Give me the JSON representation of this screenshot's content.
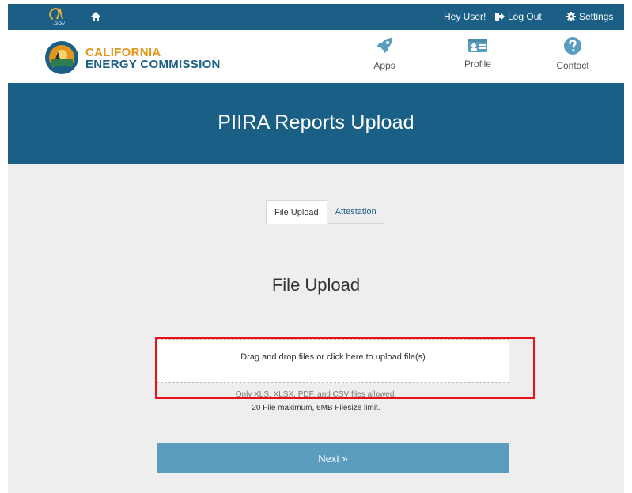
{
  "topbar": {
    "ca_logo_text": "CA.GOV",
    "home_icon": "home-icon",
    "greeting": "Hey User!",
    "logout_label": "Log Out",
    "settings_label": "Settings"
  },
  "header": {
    "brand_line1": "CALIFORNIA",
    "brand_line2": "ENERGY COMMISSION",
    "nav": [
      {
        "label": "Apps",
        "icon": "rocket-icon"
      },
      {
        "label": "Profile",
        "icon": "id-card-icon"
      },
      {
        "label": "Contact",
        "icon": "question-icon"
      }
    ]
  },
  "banner": {
    "title": "PIIRA Reports Upload"
  },
  "tabs": [
    {
      "label": "File Upload",
      "active": true
    },
    {
      "label": "Attestation",
      "active": false
    }
  ],
  "upload": {
    "section_title": "File Upload",
    "dropzone_text": "Drag and drop files or click here to upload file(s)",
    "allowed_text": "Only XLS, XLSX, PDF, and CSV files allowed.",
    "limit_text": "20 File maximum, 6MB Filesize limit."
  },
  "next_label": "Next »",
  "colors": {
    "brand_blue": "#1b5e86",
    "brand_orange": "#e3961b",
    "button_blue": "#5a9dbf",
    "highlight_red": "#e5121a"
  }
}
